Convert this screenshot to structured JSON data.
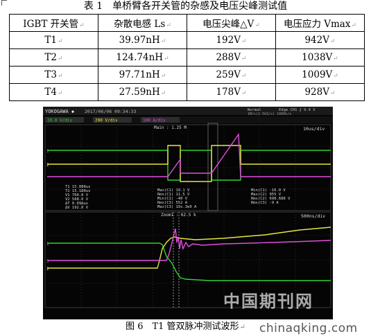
{
  "table": {
    "caption": "表 1　单桥臂各开关管的杂感及电压尖峰测试值",
    "headers": [
      "IGBT 开关管",
      "杂散电感 Ls",
      "电压尖峰△V",
      "电压应力 Vmax"
    ],
    "rows": [
      {
        "name": "T1",
        "ls": "39.97nH",
        "dv": "192V",
        "vmax": "942V"
      },
      {
        "name": "T2",
        "ls": "124.74nH",
        "dv": "288V",
        "vmax": "1038V"
      },
      {
        "name": "T3",
        "ls": "97.71nH",
        "dv": "259V",
        "vmax": "1009V"
      },
      {
        "name": "T4",
        "ls": "27.59nH",
        "dv": "178V",
        "vmax": "928V"
      }
    ]
  },
  "scope": {
    "brand": "YOKOGAWA ◆",
    "datetime": "2017/06/06 09:34:33",
    "mode": "Normal",
    "trigger": "Edge CH1 ⨍ 9.9 V",
    "sample": "1M/s(2.5GS/s)  1000k/s",
    "ch1": "10.0 V/div",
    "ch2": "200 V/div",
    "ch3": "100 A/div",
    "main": "Main : 1.25 M",
    "timebase_top": "10us/div",
    "timebase_bottom": "500ns/div",
    "zoom": "Zoom1 : 62.5 k",
    "cursors": [
      "T1  15.088us",
      "T2  15.180us",
      "V1  760.0 V",
      "V2  568.0 V",
      "ΔT  0.09Δus",
      "ΔV  192.0 V"
    ],
    "measure_mid": [
      "Max(C1)  19.1 V",
      "Rms(C1)  11.5 V",
      "Min(C1)  -40 V",
      "Rms(C3)  552 A",
      "Max(C3)  19x.3e0 A"
    ],
    "measure_right": [
      "Min(C1)  -16.0 V",
      "Max(C2)  955 V",
      "Rms(C2)  698.688 V",
      "Rms(C3)  -9 A"
    ]
  },
  "figure": {
    "caption": "图 6　T1 管双脉冲测试波形",
    "watermark": "中国期刊网",
    "site": "chinaqking.com"
  }
}
